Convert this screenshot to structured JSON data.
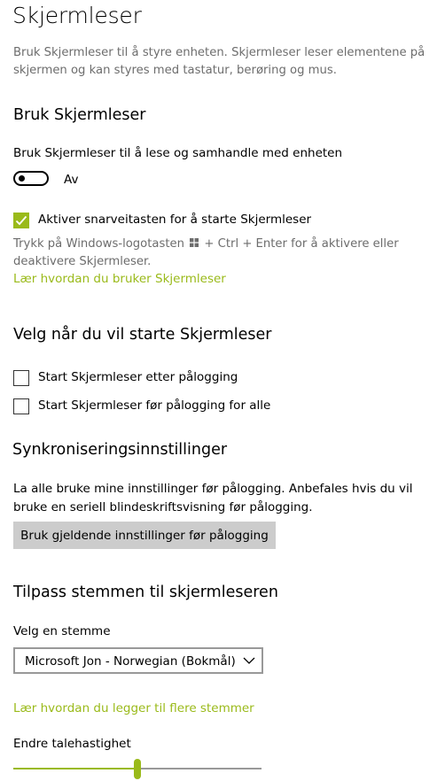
{
  "page": {
    "title": "Skjermleser",
    "description": "Bruk Skjermleser til å styre enheten. Skjermleser leser elementene på skjermen og kan styres med tastatur, berøring og mus."
  },
  "use_narrator": {
    "heading": "Bruk Skjermleser",
    "toggle_label": "Bruk Skjermleser til å lese og samhandle med enheten",
    "toggle_state": "Av",
    "shortcut_checkbox": {
      "label": "Aktiver snarveitasten for å starte Skjermleser",
      "checked": true
    },
    "shortcut_hint_before": "Trykk på Windows-logotasten",
    "shortcut_hint_after": "+ Ctrl + Enter for å aktivere eller deaktivere Skjermleser.",
    "learn_link": "Lær hvordan du bruker Skjermleser"
  },
  "start_options": {
    "heading": "Velg når du vil starte Skjermleser",
    "after_login": {
      "label": "Start Skjermleser etter pålogging",
      "checked": false
    },
    "before_login": {
      "label": "Start Skjermleser før pålogging for alle",
      "checked": false
    }
  },
  "sync": {
    "heading": "Synkroniseringsinnstillinger",
    "description": "La alle bruke mine innstillinger før pålogging. Anbefales hvis du vil bruke en seriell blindeskriftsvisning før pålogging.",
    "button_label": "Bruk gjeldende innstillinger før pålogging"
  },
  "voice": {
    "heading": "Tilpass stemmen til skjermleseren",
    "select_label": "Velg en stemme",
    "selected_voice": "Microsoft Jon - Norwegian (Bokmål)",
    "add_voices_link": "Lær hvordan du legger til flere stemmer",
    "speed_label": "Endre talehastighet",
    "speed_fraction": 0.5
  },
  "colors": {
    "accent": "#9aba1a",
    "secondary_text": "#6d6d6d",
    "button_bg": "#cccccc"
  }
}
